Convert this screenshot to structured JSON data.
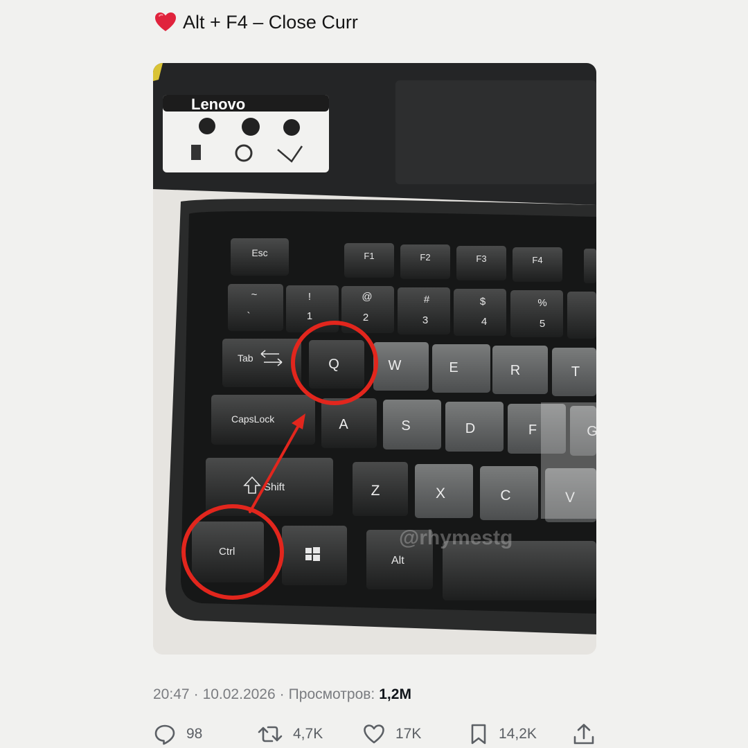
{
  "tweet": {
    "text": "Alt + F4 – Close Curr",
    "emoji": "heart-icon"
  },
  "photo": {
    "brand_label": "Lenovo",
    "watermark": "@rhymestg",
    "keys": {
      "esc": "Esc",
      "f1": "F1",
      "f2": "F2",
      "f3": "F3",
      "f4": "F4",
      "tilde_top": "~",
      "tilde_bottom": "`",
      "one_top": "!",
      "one_bottom": "1",
      "two_top": "@",
      "two_bottom": "2",
      "three_top": "#",
      "three_bottom": "3",
      "four_top": "$",
      "four_bottom": "4",
      "five_top": "%",
      "five_bottom": "5",
      "tab": "Tab",
      "q": "Q",
      "w": "W",
      "e": "E",
      "r": "R",
      "t": "T",
      "capslock": "CapsLock",
      "a": "A",
      "s": "S",
      "d": "D",
      "f": "F",
      "g": "G",
      "shift": "Shift",
      "z": "Z",
      "x": "X",
      "c": "C",
      "v": "V",
      "ctrl": "Ctrl",
      "alt": "Alt"
    },
    "annotation_color": "#e2261d"
  },
  "meta": {
    "time": "20:47",
    "separator": "·",
    "date": "10.02.2026",
    "views_label": "Просмотров:",
    "views_count": "1,2M"
  },
  "actions": {
    "replies": "98",
    "retweets": "4,7K",
    "likes": "17K",
    "bookmarks": "14,2K"
  },
  "colors": {
    "background": "#f1f1ef",
    "meta_text": "#7a7c80",
    "heart": "#e0233c"
  }
}
